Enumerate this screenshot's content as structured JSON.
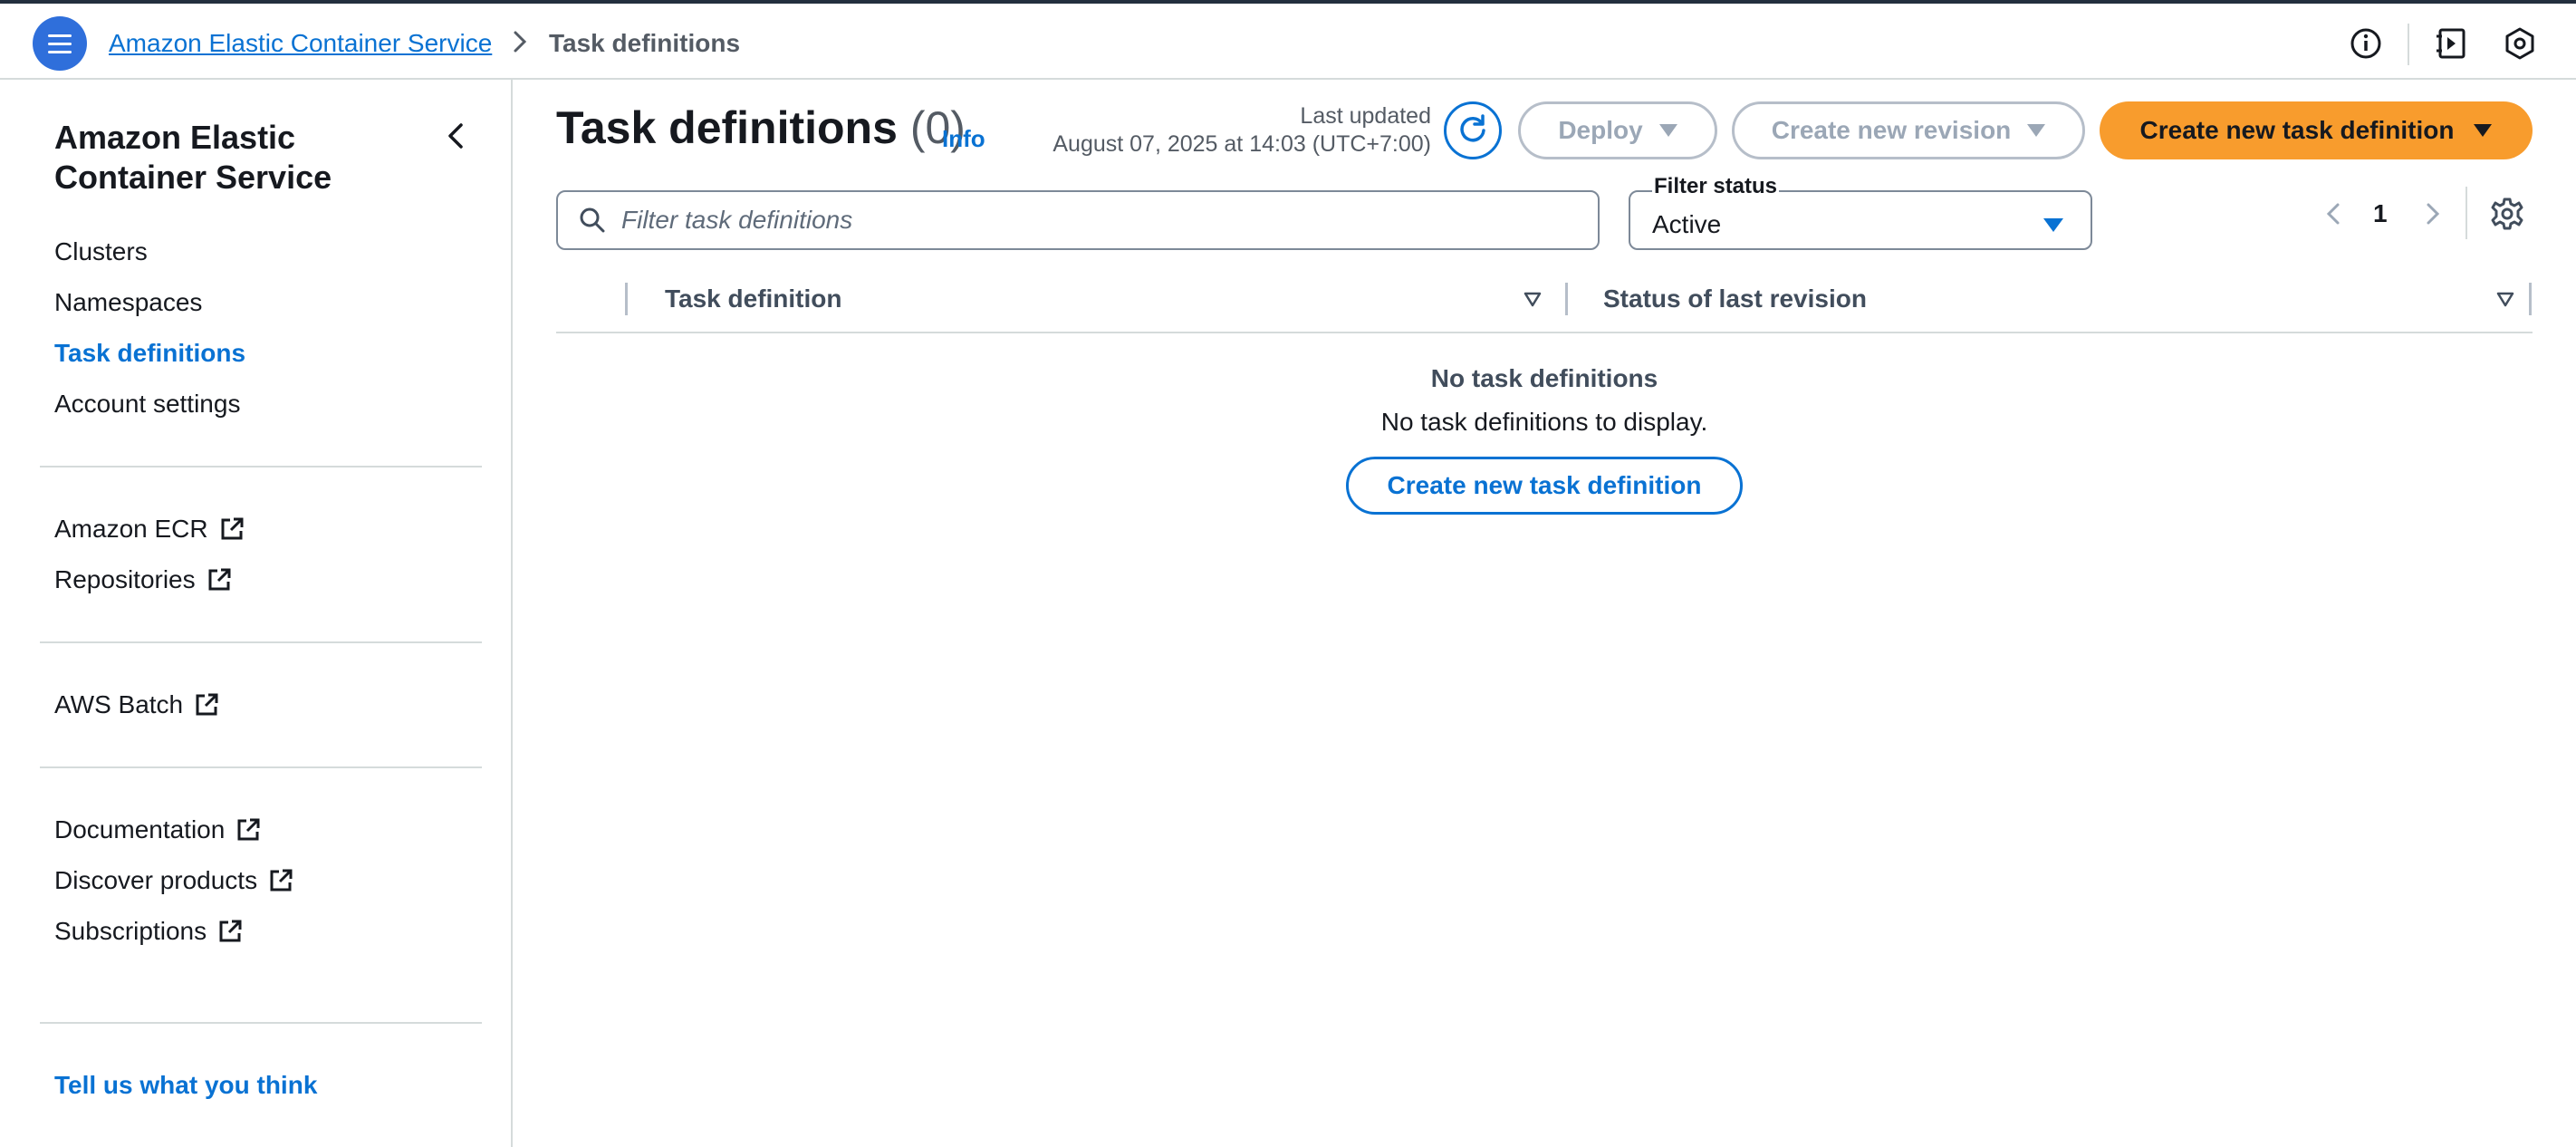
{
  "breadcrumb": {
    "parent": "Amazon Elastic Container Service",
    "current": "Task definitions"
  },
  "top_icons": [
    "info-icon",
    "notes-icon",
    "settings-hexagon-icon"
  ],
  "sidenav": {
    "title": "Amazon Elastic Container Service",
    "primary": [
      {
        "label": "Clusters",
        "active": false
      },
      {
        "label": "Namespaces",
        "active": false
      },
      {
        "label": "Task definitions",
        "active": true
      },
      {
        "label": "Account settings",
        "active": false
      }
    ],
    "ecr_links": [
      "Amazon ECR",
      "Repositories"
    ],
    "batch_links": [
      "AWS Batch"
    ],
    "resource_links": [
      "Documentation",
      "Discover products",
      "Subscriptions"
    ],
    "feedback": "Tell us what you think"
  },
  "header": {
    "title": "Task definitions",
    "count": "(0)",
    "info": "Info",
    "last_updated_label": "Last updated",
    "last_updated_value": "August 07, 2025 at 14:03 (UTC+7:00)",
    "deploy_label": "Deploy",
    "create_revision_label": "Create new revision",
    "create_label": "Create new task definition"
  },
  "filter": {
    "search_placeholder": "Filter task definitions",
    "status_label": "Filter status",
    "status_value": "Active"
  },
  "pagination": {
    "current_page": "1"
  },
  "table": {
    "columns": [
      "Task definition",
      "Status of last revision"
    ]
  },
  "empty_state": {
    "title": "No task definitions",
    "description": "No task definitions to display.",
    "button_label": "Create new task definition"
  },
  "colors": {
    "accent": "#0972d3",
    "primary_button": "#f89c2d",
    "menu_button": "#2f6fdb",
    "disabled": "#9ba7b6"
  }
}
